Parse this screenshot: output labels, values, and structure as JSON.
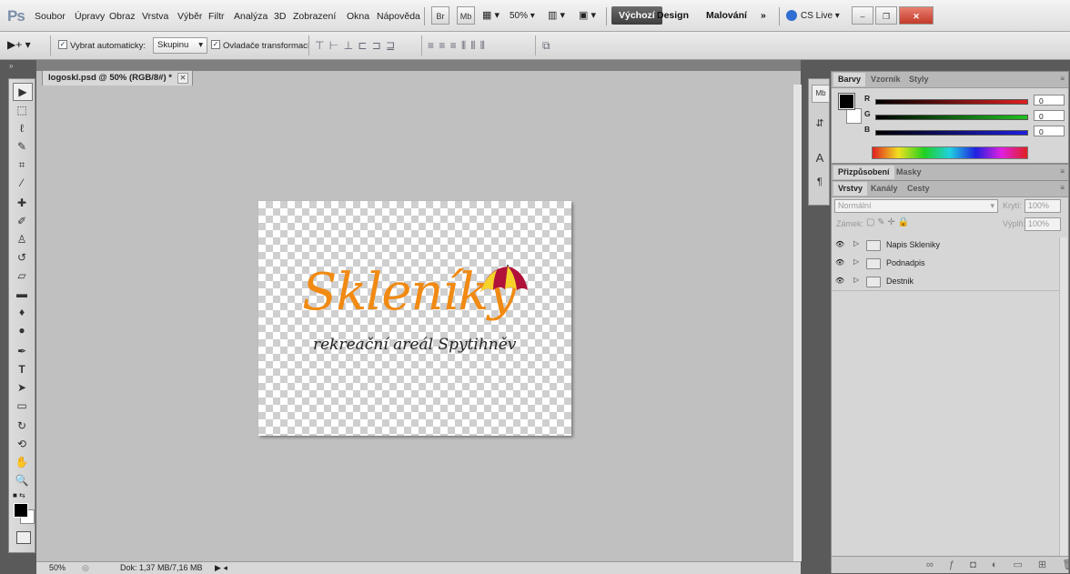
{
  "app": {
    "logo": "Ps"
  },
  "menu": [
    "Soubor",
    "Úpravy",
    "Obraz",
    "Vrstva",
    "Výběr",
    "Filtr",
    "Analýza",
    "3D",
    "Zobrazení",
    "Okna",
    "Nápověda"
  ],
  "menubar": {
    "bridge_label": "Br",
    "minibridge_label": "Mb",
    "zoom": "50%",
    "workspaces": [
      "Výchozí",
      "Design",
      "Malování"
    ],
    "more": "»",
    "cslive": "CS Live"
  },
  "options": {
    "auto_select_label": "Vybrat automaticky:",
    "auto_select_checked": true,
    "auto_select_value": "Skupinu",
    "transform_label": "Ovladače transformací",
    "transform_checked": true
  },
  "document": {
    "tab_title": "logoskl.psd @ 50% (RGB/8#) *",
    "logo_text": "Skleníky",
    "logo_subtext": "rekreační areál Spytihněv"
  },
  "status": {
    "zoom": "50%",
    "doc": "Dok: 1,37 MB/7,16 MB"
  },
  "color_panel": {
    "tabs": [
      "Barvy",
      "Vzorník",
      "Styly"
    ],
    "channels": [
      {
        "label": "R",
        "value": "0",
        "color": "#d42020"
      },
      {
        "label": "G",
        "value": "0",
        "color": "#1fb21f"
      },
      {
        "label": "B",
        "value": "0",
        "color": "#1f1fd0"
      }
    ]
  },
  "adjust_panel": {
    "tabs": [
      "Přizpůsobení",
      "Masky"
    ]
  },
  "layers_panel": {
    "tabs": [
      "Vrstvy",
      "Kanály",
      "Cesty"
    ],
    "blend_mode": "Normální",
    "opacity_label": "Krytí:",
    "opacity_value": "100%",
    "lock_label": "Zámek:",
    "fill_label": "Výplň:",
    "fill_value": "100%",
    "layers": [
      {
        "name": "Napis Skleniky"
      },
      {
        "name": "Podnadpis"
      },
      {
        "name": "Destnik"
      }
    ]
  },
  "colors": {
    "accent_orange": "#f08a13",
    "umbrella_red": "#b0123a",
    "umbrella_yellow": "#f6d32a"
  }
}
